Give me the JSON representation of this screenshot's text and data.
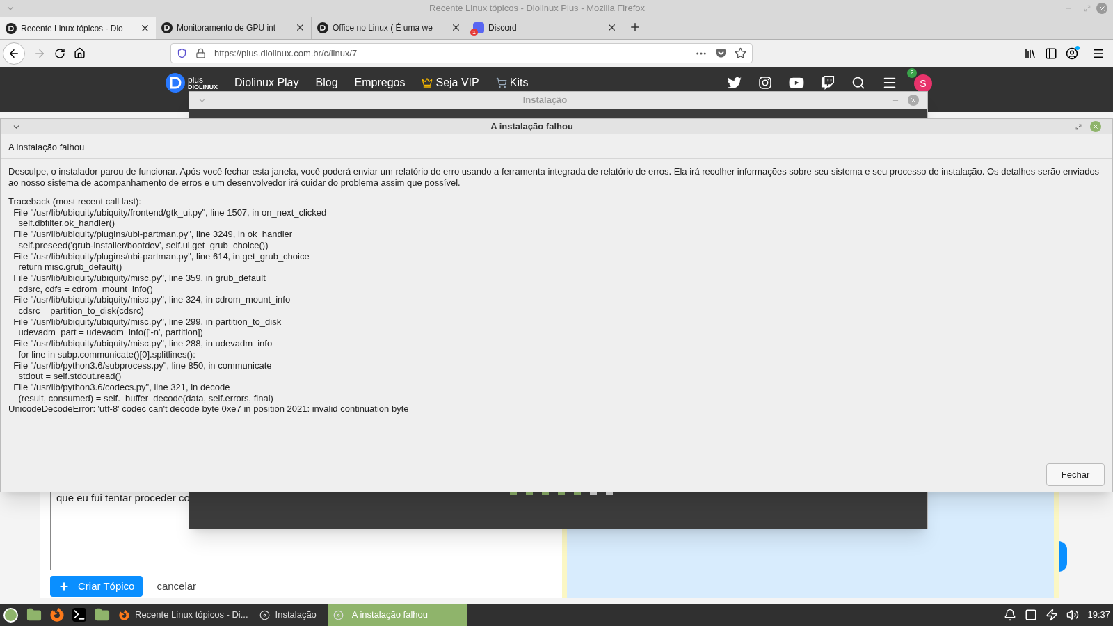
{
  "firefox": {
    "window_title": "Recente Linux tópicos - Diolinux Plus - Mozilla Firefox",
    "tabs": [
      {
        "label": "Recente Linux tópicos - Dio",
        "selected": true
      },
      {
        "label": "Monitoramento de GPU int",
        "selected": false
      },
      {
        "label": "Office no Linux ( É uma we",
        "selected": false
      },
      {
        "label": "Discord",
        "selected": false,
        "badge": "1"
      }
    ],
    "url": "https://plus.diolinux.com.br/c/linux/7"
  },
  "site_header": {
    "logo_text": "plus",
    "logo_subtext": "DIOLINUX",
    "nav": [
      {
        "label": "Diolinux Play",
        "kind": "plain"
      },
      {
        "label": "Blog",
        "kind": "plain"
      },
      {
        "label": "Empregos",
        "kind": "plain"
      },
      {
        "label": "Seja VIP",
        "kind": "crown"
      },
      {
        "label": "Kits",
        "kind": "cart"
      }
    ],
    "notification_count": "2",
    "avatar_initial": "S"
  },
  "composer": {
    "text": "que eu fui tentar proceder co",
    "submit": "Criar Tópico",
    "cancel": "cancelar"
  },
  "install_window": {
    "title": "Instalação",
    "progress_steps": [
      {
        "done": true
      },
      {
        "done": true
      },
      {
        "done": true
      },
      {
        "done": true
      },
      {
        "done": true
      },
      {
        "done": false
      },
      {
        "done": false
      }
    ]
  },
  "error_dialog": {
    "title": "A instalação falhou",
    "heading": "A instalação falhou",
    "message": "Desculpe, o instalador parou de funcionar. Após você fechar esta janela, você poderá enviar um relatório de erro usando a ferramenta integrada de relatório de erros. Ela irá recolher informações sobre seu sistema e seu processo de instalação. Os detalhes serão enviados ao nosso sistema de acompanhamento de erros e um desenvolvedor irá cuidar do problema assim que possível.",
    "traceback": [
      "Traceback (most recent call last):",
      "  File \"/usr/lib/ubiquity/ubiquity/frontend/gtk_ui.py\", line 1507, in on_next_clicked",
      "    self.dbfilter.ok_handler()",
      "  File \"/usr/lib/ubiquity/plugins/ubi-partman.py\", line 3249, in ok_handler",
      "    self.preseed('grub-installer/bootdev', self.ui.get_grub_choice())",
      "  File \"/usr/lib/ubiquity/plugins/ubi-partman.py\", line 614, in get_grub_choice",
      "    return misc.grub_default()",
      "  File \"/usr/lib/ubiquity/ubiquity/misc.py\", line 359, in grub_default",
      "    cdsrc, cdfs = cdrom_mount_info()",
      "  File \"/usr/lib/ubiquity/ubiquity/misc.py\", line 324, in cdrom_mount_info",
      "    cdsrc = partition_to_disk(cdsrc)",
      "  File \"/usr/lib/ubiquity/ubiquity/misc.py\", line 299, in partition_to_disk",
      "    udevadm_part = udevadm_info(['-n', partition])",
      "  File \"/usr/lib/ubiquity/ubiquity/misc.py\", line 288, in udevadm_info",
      "    for line in subp.communicate()[0].splitlines():",
      "  File \"/usr/lib/python3.6/subprocess.py\", line 850, in communicate",
      "    stdout = self.stdout.read()",
      "  File \"/usr/lib/python3.6/codecs.py\", line 321, in decode",
      "    (result, consumed) = self._buffer_decode(data, self.errors, final)",
      "UnicodeDecodeError: 'utf-8' codec can't decode byte 0xe7 in position 2021: invalid continuation byte"
    ],
    "close_button": "Fechar"
  },
  "taskbar": {
    "windows": [
      {
        "label": "Recente Linux tópicos - Di...",
        "kind": "firefox",
        "selected": false
      },
      {
        "label": "Instalação",
        "kind": "disc",
        "selected": false
      },
      {
        "label": "A instalação falhou",
        "kind": "disc",
        "selected": true
      }
    ],
    "clock": "19:37"
  }
}
